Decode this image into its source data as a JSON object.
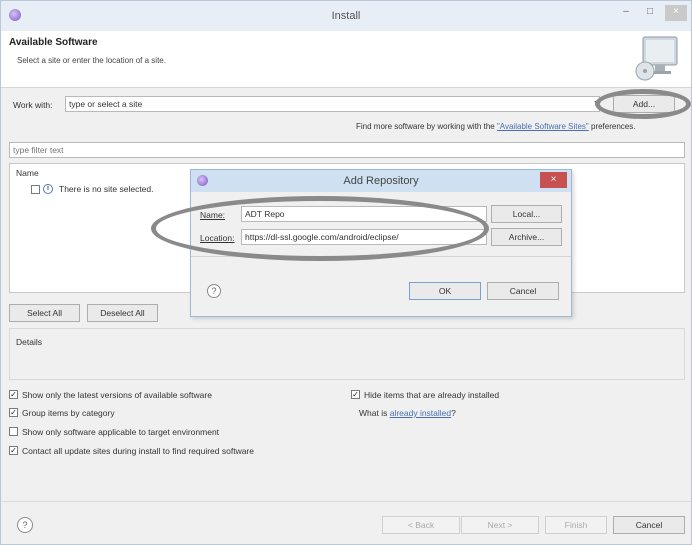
{
  "window": {
    "title": "Install",
    "minimize_glyph": "–",
    "maximize_glyph": "□",
    "close_glyph": "×"
  },
  "header": {
    "title": "Available Software",
    "subtitle": "Select a site or enter the location of a site."
  },
  "work_with": {
    "label": "Work with:",
    "value": "type or select a site",
    "add_label": "Add...",
    "hint_prefix": "Find more software by working with the ",
    "hint_link": "\"Available Software Sites\"",
    "hint_suffix": " preferences."
  },
  "filter": {
    "placeholder": "type filter text"
  },
  "tree": {
    "column_name": "Name",
    "empty_item": "There is no site selected."
  },
  "buttons": {
    "select_all": "Select All",
    "deselect_all": "Deselect All"
  },
  "details": {
    "label": "Details"
  },
  "options": {
    "latest_versions": {
      "label": "Show only the latest versions of available software",
      "checked": true
    },
    "hide_installed": {
      "label": "Hide items that are already installed",
      "checked": true
    },
    "group_by_category": {
      "label": "Group items by category",
      "checked": true
    },
    "what_is_prefix": "What is ",
    "what_is_link": "already installed",
    "what_is_suffix": "?",
    "target_env": {
      "label": "Show only software applicable to target environment",
      "checked": false
    },
    "contact_sites": {
      "label": "Contact all update sites during install to find required software",
      "checked": true
    }
  },
  "footer": {
    "back": "< Back",
    "next": "Next >",
    "finish": "Finish",
    "cancel": "Cancel"
  },
  "dialog": {
    "title": "Add Repository",
    "close_glyph": "×",
    "name_label": "Name:",
    "name_value": "ADT Repo",
    "local_button": "Local...",
    "location_label": "Location:",
    "location_value": "https://dl-ssl.google.com/android/eclipse/",
    "archive_button": "Archive...",
    "ok": "OK",
    "cancel": "Cancel"
  },
  "icons": {
    "app": "eclipse-icon",
    "banner": "monitor-install-icon",
    "help": "help-icon",
    "info": "info-icon"
  }
}
